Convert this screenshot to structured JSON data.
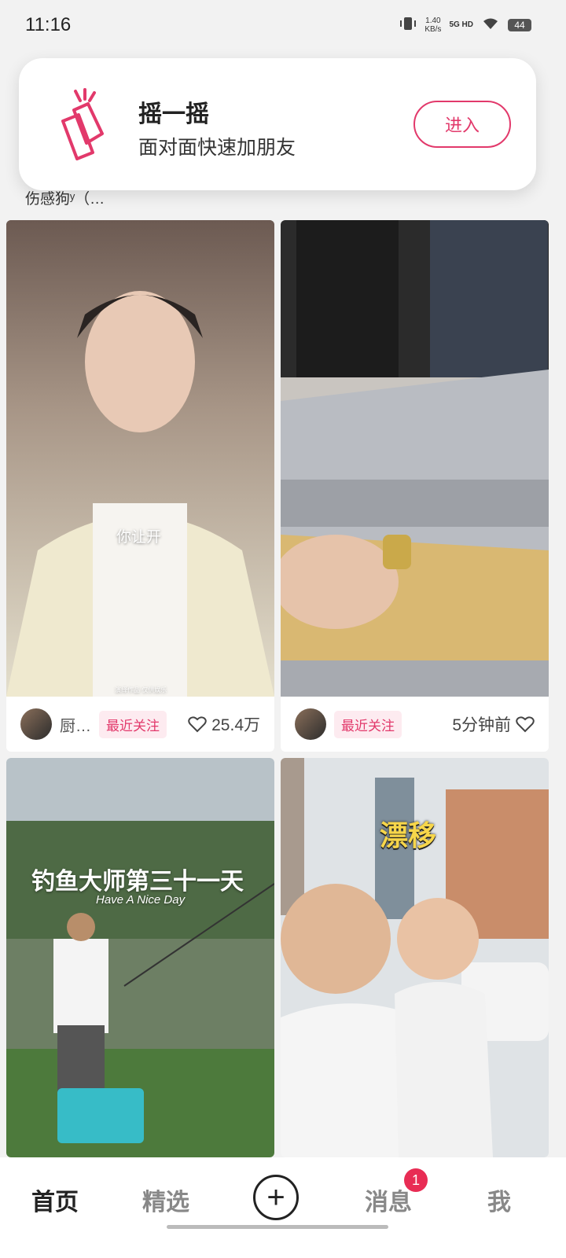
{
  "status": {
    "time": "11:16",
    "net_speed_value": "1.40",
    "net_speed_unit": "KB/s",
    "network": "5G HD",
    "battery": "44"
  },
  "clip_title": "伤感狗ʸ（…",
  "shake": {
    "title": "摇一摇",
    "subtitle": "面对面快速加朋友",
    "button": "进入",
    "accent": "#e2396b"
  },
  "cards": [
    {
      "overlay_text": "你让开",
      "watermark": "演绎作品 仅供娱乐",
      "author": "厨…",
      "tag": "最近关注",
      "likes": "25.4万"
    },
    {
      "overlay_text": "",
      "author": "",
      "tag": "最近关注",
      "time": "5分钟前"
    },
    {
      "overlay_title": "钓鱼大师第三十一天",
      "overlay_sub": "Have A Nice Day"
    },
    {
      "overlay_title": "漂移"
    }
  ],
  "tabs": [
    "首页",
    "精选",
    "消息",
    "我"
  ],
  "active_tab": "首页",
  "messages_badge": "1",
  "plus_icon": "+"
}
